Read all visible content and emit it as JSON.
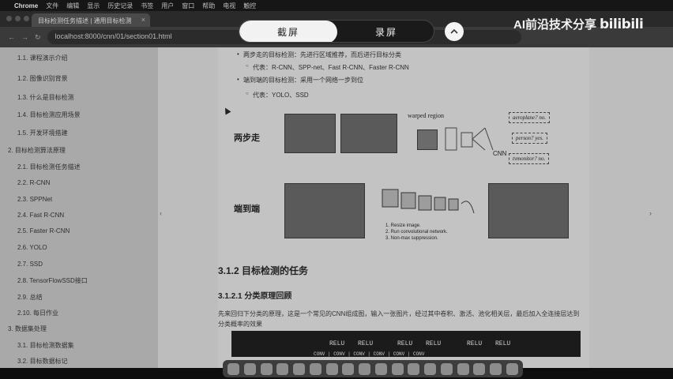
{
  "menubar": {
    "app": "Chrome",
    "items": [
      "文件",
      "编辑",
      "显示",
      "历史记录",
      "书签",
      "用户",
      "窗口",
      "帮助",
      "电视",
      "触控"
    ]
  },
  "browser": {
    "tab_title": "目标检测任务描述 | 通用目标检测",
    "url": "localhost:8000/cnn/01/section01.html"
  },
  "sidebar": {
    "items": [
      {
        "num": "1.1.",
        "label": "课程演示介绍"
      },
      {
        "num": "1.2.",
        "label": "图像识别背景"
      },
      {
        "num": "1.3.",
        "label": "什么是目标检测"
      },
      {
        "num": "1.4.",
        "label": "目标检测应用场景"
      },
      {
        "num": "1.5.",
        "label": "开发环境搭建"
      },
      {
        "num": "2.",
        "label": "目标检测算法原理"
      },
      {
        "num": "2.1.",
        "label": "目标检测任务描述"
      },
      {
        "num": "2.2.",
        "label": "R-CNN"
      },
      {
        "num": "2.3.",
        "label": "SPPNet"
      },
      {
        "num": "2.4.",
        "label": "Fast R-CNN"
      },
      {
        "num": "2.5.",
        "label": "Faster R-CNN"
      },
      {
        "num": "2.6.",
        "label": "YOLO"
      },
      {
        "num": "2.7.",
        "label": "SSD"
      },
      {
        "num": "2.8.",
        "label": "TensorFlowSSD接口"
      },
      {
        "num": "2.9.",
        "label": "总结"
      },
      {
        "num": "2.10.",
        "label": "每日作业"
      },
      {
        "num": "3.",
        "label": "数据集处理"
      },
      {
        "num": "3.1.",
        "label": "目标检测数据集"
      },
      {
        "num": "3.2.",
        "label": "目标数据标记"
      }
    ]
  },
  "content": {
    "line_top": "两步走的目标检测：先进行区域推荐，而后进行目标分类",
    "bullet_rcnn": "代表：R-CNN、SPP-net、Fast R-CNN、Faster R-CNN",
    "line_end2end": "端到端的目标检测：采用一个网络一步到位",
    "bullet_yolo": "代表：YOLO、SSD",
    "fig_label_twostep": "两步走",
    "fig_label_end2end": "端到端",
    "fig_warped": "warped region",
    "fig_cnn": "CNN",
    "fig_notes": [
      "aeroplane? no.",
      "person? yes.",
      "tvmonitor? no."
    ],
    "fig_steps": [
      "1. Resize image.",
      "2. Run convolutional network.",
      "3. Non-max suppression."
    ],
    "h2": "3.1.2 目标检测的任务",
    "h3": "3.1.2.1 分类原理回顾",
    "para": "先来回归下分类的原理，这是一个常见的CNN组成图，输入一张图片，经过其中卷积、激活、池化相关层，最后加入全连接层达到分类概率的效果",
    "cnn_labels": [
      "RELU",
      "RELU",
      "RELU",
      "RELU",
      "RELU",
      "RELU"
    ],
    "cnn_bottom": "CONV | CONV | CONV | CONV | CONV | CONV"
  },
  "overlay": {
    "screenshot_label": "截屏",
    "record_label": "录屏",
    "up_icon": "chevron-up-icon",
    "watermark": "AI前沿技术分享",
    "watermark_brand": "bilibili"
  },
  "colors": {
    "pill_active": "#f2f2f2",
    "pill_bg": "#1a1a1a"
  }
}
